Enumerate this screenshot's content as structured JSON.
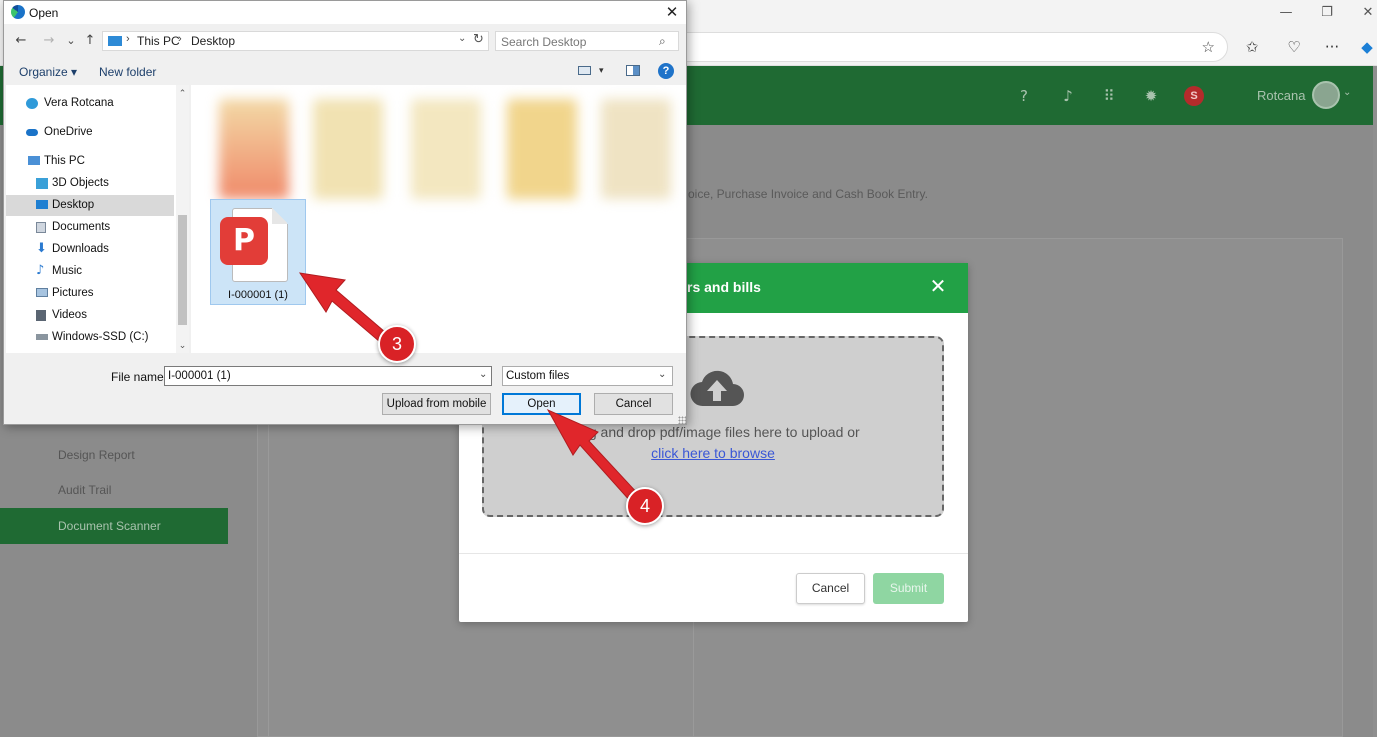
{
  "browser": {
    "window_controls": {
      "minimize": "—",
      "restore": "❐",
      "close": "✕"
    },
    "toolbar_icons": [
      "favorite-star-icon",
      "favorites-icon",
      "browser-essentials-icon",
      "more-icon",
      "copilot-icon"
    ],
    "more_label": "···"
  },
  "app": {
    "header": {
      "icons": [
        "help-icon",
        "bell-icon",
        "apps-grid-icon",
        "settings-icon"
      ],
      "badge": "S",
      "user_name": "Rotcana"
    },
    "description_fragment": "oice, Purchase Invoice and Cash Book Entry.",
    "sidebar": {
      "items": [
        {
          "label": "Design Report",
          "active": false
        },
        {
          "label": "Audit Trail",
          "active": false
        },
        {
          "label": "Document Scanner",
          "active": true
        }
      ]
    },
    "colors": {
      "header": "#1f6a33",
      "modal_header": "#22a146",
      "accent_link": "#3a57d6",
      "submit_disabled": "#8fd6a2"
    }
  },
  "upload_modal": {
    "title_fragment": "rs and bills",
    "close_glyph": "✕",
    "drop_text": "Drag and drop pdf/image files here to upload or",
    "browse_link": "click here to browse",
    "cancel_label": "Cancel",
    "submit_label": "Submit"
  },
  "open_dialog": {
    "title": "Open",
    "close_glyph": "✕",
    "nav": {
      "back": "←",
      "forward": "→",
      "recent": "⌄",
      "up": "↑"
    },
    "breadcrumb": [
      "This PC",
      "Desktop"
    ],
    "search_placeholder": "Search Desktop",
    "commands": {
      "organize": "Organize ▾",
      "new_folder": "New folder",
      "help": "?"
    },
    "tree": [
      {
        "label": "Vera Rotcana",
        "icon": "user-folder-icon",
        "indent": 0,
        "selected": false
      },
      {
        "label": "OneDrive",
        "icon": "onedrive-cloud-icon",
        "indent": 0,
        "selected": false
      },
      {
        "label": "This PC",
        "icon": "computer-icon",
        "indent": 0,
        "selected": false
      },
      {
        "label": "3D Objects",
        "icon": "3d-objects-icon",
        "indent": 1,
        "selected": false
      },
      {
        "label": "Desktop",
        "icon": "desktop-icon",
        "indent": 1,
        "selected": true
      },
      {
        "label": "Documents",
        "icon": "documents-icon",
        "indent": 1,
        "selected": false
      },
      {
        "label": "Downloads",
        "icon": "downloads-icon",
        "indent": 1,
        "selected": false
      },
      {
        "label": "Music",
        "icon": "music-icon",
        "indent": 1,
        "selected": false
      },
      {
        "label": "Pictures",
        "icon": "pictures-icon",
        "indent": 1,
        "selected": false
      },
      {
        "label": "Videos",
        "icon": "videos-icon",
        "indent": 1,
        "selected": false
      },
      {
        "label": "Windows-SSD (C:)",
        "icon": "drive-icon",
        "indent": 1,
        "selected": false
      }
    ],
    "files": [
      {
        "name": "I-000001 (1)",
        "icon": "pdf-file-icon",
        "selected": true
      }
    ],
    "file_name_label": "File name:",
    "file_name_value": "I-000001 (1)",
    "file_type_value": "Custom files",
    "buttons": {
      "upload_mobile": "Upload from mobile",
      "open": "Open",
      "cancel": "Cancel"
    }
  },
  "annotations": {
    "step_3": "3",
    "step_4": "4"
  }
}
